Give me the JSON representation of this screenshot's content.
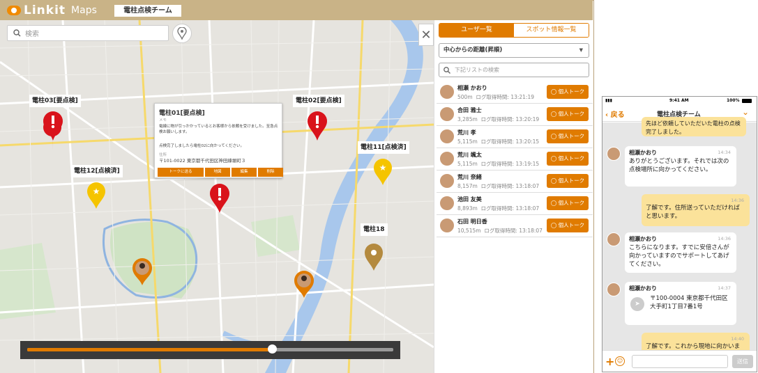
{
  "app": {
    "brand": "Linkit",
    "product": "Maps",
    "team": "電柱点検チーム"
  },
  "colors": {
    "accent": "#e07b00",
    "topbar": "#c9b387",
    "pin_red": "#d9131b",
    "pin_yellow": "#f5c400",
    "pin_gold": "#b48a3f"
  },
  "search": {
    "placeholder": "検索"
  },
  "map": {
    "labels": {
      "p03": "電柱03[要点検]",
      "p02": "電柱02[要点検]",
      "p11": "電柱11[点検済]",
      "p12": "電柱12[点検済]",
      "p18": "電柱18"
    },
    "popup": {
      "title": "電柱01[要点検]",
      "memo_label": "メモ",
      "memo": "電線に物が引っかかっているとお客様から依頼を受けました。至急点検お願いします。",
      "note": "点検完了しましたら電柱02に向かってください。",
      "addr_label": "住所",
      "address": "〒101-0022 東京都千代田区神田練塀町３",
      "buttons": [
        "トークに送る",
        "地図",
        "編集",
        "削除"
      ]
    },
    "playback_progress": 0.669
  },
  "panel": {
    "tabs": [
      "ユーザ一覧",
      "スポット情報一覧"
    ],
    "sort": "中心からの距離(昇順)",
    "list_search_placeholder": "下記リストの検索",
    "talk_label": "個人トーク",
    "users": [
      {
        "name": "相瀬 かおり",
        "dist": "500m",
        "log": "ログ取得時間: 13:21:19"
      },
      {
        "name": "合田 雅士",
        "dist": "3,285m",
        "log": "ログ取得時間: 13:20:19"
      },
      {
        "name": "荒川 孝",
        "dist": "5,115m",
        "log": "ログ取得時間: 13:20:15"
      },
      {
        "name": "荒川 颯太",
        "dist": "5,115m",
        "log": "ログ取得時間: 13:19:15"
      },
      {
        "name": "荒川 奈緒",
        "dist": "8,157m",
        "log": "ログ取得時間: 13:18:07"
      },
      {
        "name": "池田 友美",
        "dist": "8,893m",
        "log": "ログ取得時間: 13:18:07"
      },
      {
        "name": "石田 明日香",
        "dist": "10,515m",
        "log": "ログ取得時間: 13:18:07"
      }
    ]
  },
  "phone": {
    "status": {
      "time": "9:41 AM",
      "battery": "100%"
    },
    "back": "戻る",
    "title": "電柱点検チーム",
    "first_msg": "先ほど依頼していただいた電柱の点検完了しました。",
    "messages": [
      {
        "name": "相瀬かおり",
        "time": "14:34",
        "text": "ありがとうございます。それでは次の点検場所に向かってください。"
      },
      {
        "me": true,
        "time": "14:36",
        "text": "了解です。住所送っていただければと思います。"
      },
      {
        "name": "相瀬かおり",
        "time": "14:36",
        "text": "こちらになります。すでに安倍さんが向かっていますのでサポートしてあげてください。"
      },
      {
        "name": "相瀬かおり",
        "time": "14:37",
        "text": "〒100-0004 東京都千代田区 大手町1丁目7番1号"
      },
      {
        "me": true,
        "time": "14:40",
        "text": "了解です。これから現地に向かいます。"
      }
    ],
    "send": "送信"
  }
}
